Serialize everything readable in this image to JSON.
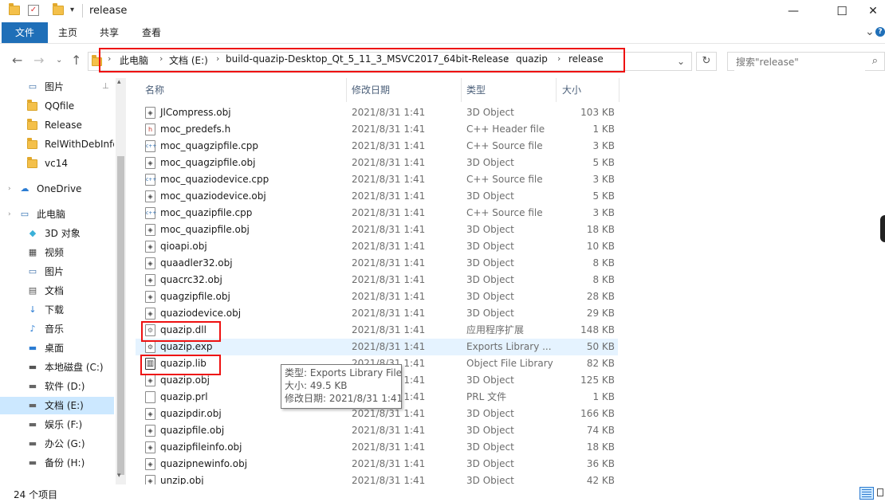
{
  "window": {
    "title": "release",
    "minimize": "—",
    "maximize": "☐",
    "close": "✕",
    "ribbon_collapse": "⌄",
    "help": "?"
  },
  "ribbon": {
    "tabs": [
      "文件",
      "主页",
      "共享",
      "查看"
    ]
  },
  "address": {
    "breadcrumb": [
      "此电脑",
      "文档 (E:)",
      "build-quazip-Desktop_Qt_5_11_3_MSVC2017_64bit-Release",
      "quazip",
      "release"
    ],
    "search_placeholder": "搜索\"release\""
  },
  "sidebar": {
    "items": [
      {
        "label": "图片",
        "icon": "pictures-icon",
        "pinned": true
      },
      {
        "label": "QQfile",
        "icon": "folder-icon"
      },
      {
        "label": "Release",
        "icon": "folder-icon"
      },
      {
        "label": "RelWithDebInfo",
        "icon": "folder-icon"
      },
      {
        "label": "vc14",
        "icon": "folder-icon"
      },
      {
        "label": "OneDrive",
        "icon": "cloud-icon"
      },
      {
        "label": "此电脑",
        "icon": "computer-icon"
      },
      {
        "label": "3D 对象",
        "icon": "3d-objects-icon"
      },
      {
        "label": "视频",
        "icon": "video-icon"
      },
      {
        "label": "图片",
        "icon": "pictures-icon"
      },
      {
        "label": "文档",
        "icon": "documents-icon"
      },
      {
        "label": "下载",
        "icon": "download-icon"
      },
      {
        "label": "音乐",
        "icon": "music-icon"
      },
      {
        "label": "桌面",
        "icon": "desktop-icon"
      },
      {
        "label": "本地磁盘 (C:)",
        "icon": "system-drive-icon"
      },
      {
        "label": "软件 (D:)",
        "icon": "drive-icon"
      },
      {
        "label": "文档 (E:)",
        "icon": "drive-icon",
        "selected": true
      },
      {
        "label": "娱乐 (F:)",
        "icon": "drive-icon"
      },
      {
        "label": "办公 (G:)",
        "icon": "drive-icon"
      },
      {
        "label": "备份 (H:)",
        "icon": "drive-icon"
      }
    ]
  },
  "columns": [
    "名称",
    "修改日期",
    "类型",
    "大小"
  ],
  "files": [
    {
      "name": "JlCompress.obj",
      "date": "2021/8/31 1:41",
      "type": "3D Object",
      "size": "103 KB",
      "icon": "obj-icon"
    },
    {
      "name": "moc_predefs.h",
      "date": "2021/8/31 1:41",
      "type": "C++ Header file",
      "size": "1 KB",
      "icon": "header-icon"
    },
    {
      "name": "moc_quagzipfile.cpp",
      "date": "2021/8/31 1:41",
      "type": "C++ Source file",
      "size": "3 KB",
      "icon": "cpp-icon"
    },
    {
      "name": "moc_quagzipfile.obj",
      "date": "2021/8/31 1:41",
      "type": "3D Object",
      "size": "5 KB",
      "icon": "obj-icon"
    },
    {
      "name": "moc_quaziodevice.cpp",
      "date": "2021/8/31 1:41",
      "type": "C++ Source file",
      "size": "3 KB",
      "icon": "cpp-icon"
    },
    {
      "name": "moc_quaziodevice.obj",
      "date": "2021/8/31 1:41",
      "type": "3D Object",
      "size": "5 KB",
      "icon": "obj-icon"
    },
    {
      "name": "moc_quazipfile.cpp",
      "date": "2021/8/31 1:41",
      "type": "C++ Source file",
      "size": "3 KB",
      "icon": "cpp-icon"
    },
    {
      "name": "moc_quazipfile.obj",
      "date": "2021/8/31 1:41",
      "type": "3D Object",
      "size": "18 KB",
      "icon": "obj-icon"
    },
    {
      "name": "qioapi.obj",
      "date": "2021/8/31 1:41",
      "type": "3D Object",
      "size": "10 KB",
      "icon": "obj-icon"
    },
    {
      "name": "quaadler32.obj",
      "date": "2021/8/31 1:41",
      "type": "3D Object",
      "size": "8 KB",
      "icon": "obj-icon"
    },
    {
      "name": "quacrc32.obj",
      "date": "2021/8/31 1:41",
      "type": "3D Object",
      "size": "8 KB",
      "icon": "obj-icon"
    },
    {
      "name": "quagzipfile.obj",
      "date": "2021/8/31 1:41",
      "type": "3D Object",
      "size": "28 KB",
      "icon": "obj-icon"
    },
    {
      "name": "quaziodevice.obj",
      "date": "2021/8/31 1:41",
      "type": "3D Object",
      "size": "29 KB",
      "icon": "obj-icon"
    },
    {
      "name": "quazip.dll",
      "date": "2021/8/31 1:41",
      "type": "应用程序扩展",
      "size": "148 KB",
      "icon": "dll-icon",
      "highlighted": true
    },
    {
      "name": "quazip.exp",
      "date": "2021/8/31 1:41",
      "type": "Exports Library ...",
      "size": "50 KB",
      "icon": "exp-icon",
      "hover": true
    },
    {
      "name": "quazip.lib",
      "date": "2021/8/31 1:41",
      "type": "Object File Library",
      "size": "82 KB",
      "icon": "lib-icon",
      "highlighted": true
    },
    {
      "name": "quazip.obj",
      "date": "2021/8/31 1:41",
      "type": "3D Object",
      "size": "125 KB",
      "icon": "obj-icon"
    },
    {
      "name": "quazip.prl",
      "date": "2021/8/31 1:41",
      "type": "PRL 文件",
      "size": "1 KB",
      "icon": "file-icon"
    },
    {
      "name": "quazipdir.obj",
      "date": "2021/8/31 1:41",
      "type": "3D Object",
      "size": "166 KB",
      "icon": "obj-icon"
    },
    {
      "name": "quazipfile.obj",
      "date": "2021/8/31 1:41",
      "type": "3D Object",
      "size": "74 KB",
      "icon": "obj-icon"
    },
    {
      "name": "quazipfileinfo.obj",
      "date": "2021/8/31 1:41",
      "type": "3D Object",
      "size": "18 KB",
      "icon": "obj-icon"
    },
    {
      "name": "quazipnewinfo.obj",
      "date": "2021/8/31 1:41",
      "type": "3D Object",
      "size": "36 KB",
      "icon": "obj-icon"
    },
    {
      "name": "unzip.obj",
      "date": "2021/8/31 1:41",
      "type": "3D Object",
      "size": "42 KB",
      "icon": "obj-icon"
    }
  ],
  "tooltip": {
    "line1": "类型: Exports Library File",
    "line2": "大小: 49.5 KB",
    "line3": "修改日期: 2021/8/31 1:41"
  },
  "status": {
    "count": "24 个项目"
  },
  "colors": {
    "accent": "#1f6fb8",
    "selection": "#cce8ff",
    "hover": "#e5f3ff",
    "annotation": "#ee1111"
  }
}
